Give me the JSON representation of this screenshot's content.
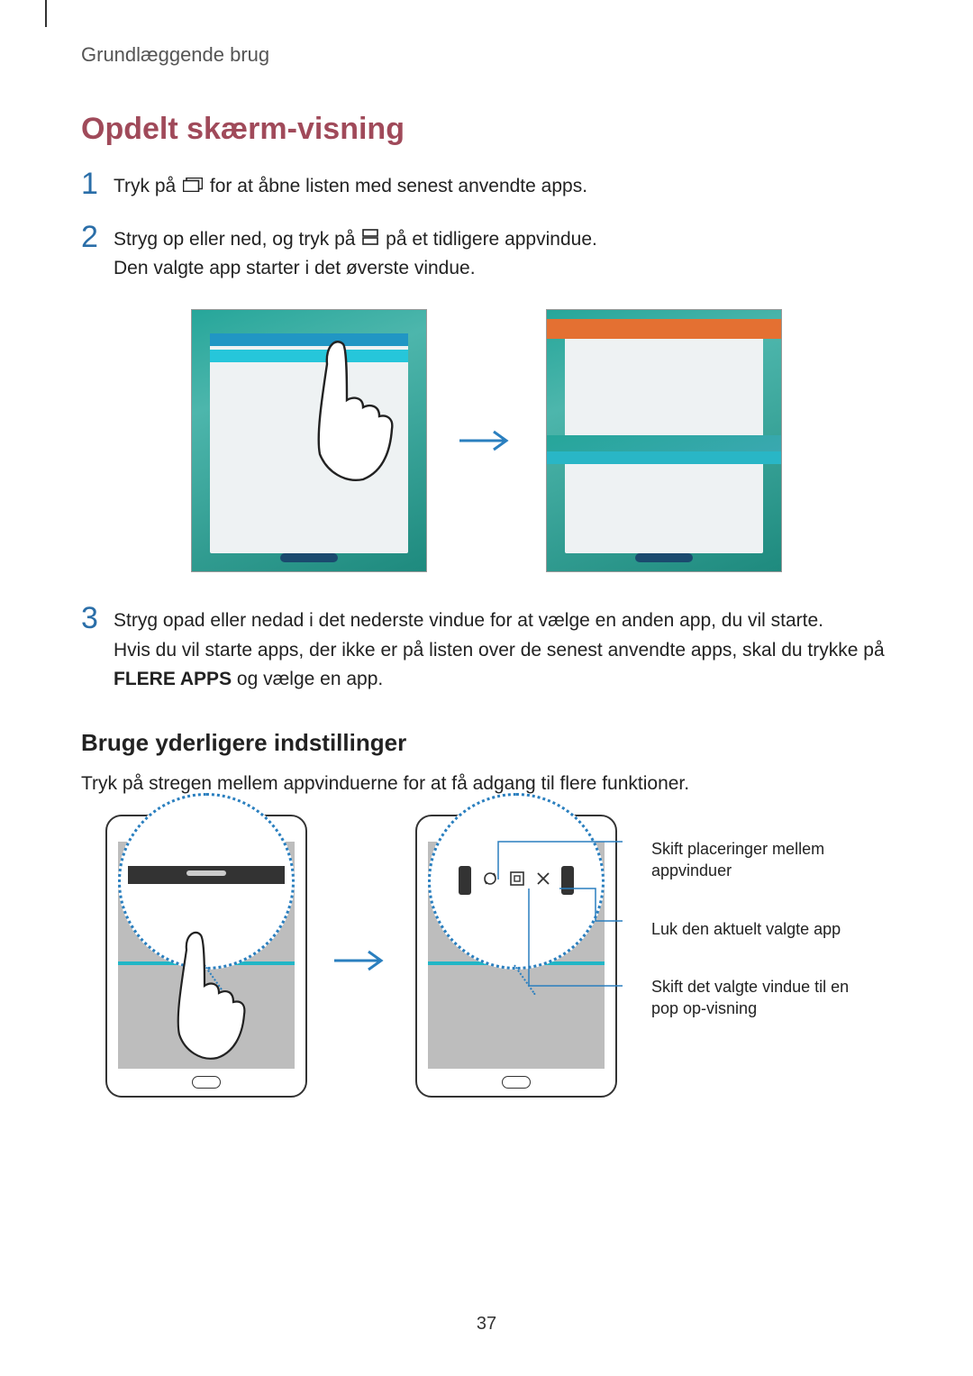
{
  "header": "Grundlæggende brug",
  "title": "Opdelt skærm-visning",
  "steps": {
    "s1": {
      "num": "1",
      "pre": "Tryk på ",
      "post": " for at åbne listen med senest anvendte apps."
    },
    "s2": {
      "num": "2",
      "pre": "Stryg op eller ned, og tryk på ",
      "post": " på et tidligere appvindue.",
      "line2": "Den valgte app starter i det øverste vindue."
    },
    "s3": {
      "num": "3",
      "line1": "Stryg opad eller nedad i det nederste vindue for at vælge en anden app, du vil starte.",
      "line2a": "Hvis du vil starte apps, der ikke er på listen over de senest anvendte apps, skal du trykke på ",
      "bold": "FLERE APPS",
      "line2b": " og vælge en app."
    }
  },
  "sub_heading": "Bruge yderligere indstillinger",
  "body_text": "Tryk på stregen mellem appvinduerne for at få adgang til flere funktioner.",
  "callouts": {
    "c1": "Skift placeringer mellem appvinduer",
    "c2": "Luk den aktuelt valgte app",
    "c3": "Skift det valgte vindue til en pop op-visning"
  },
  "page_number": "37"
}
